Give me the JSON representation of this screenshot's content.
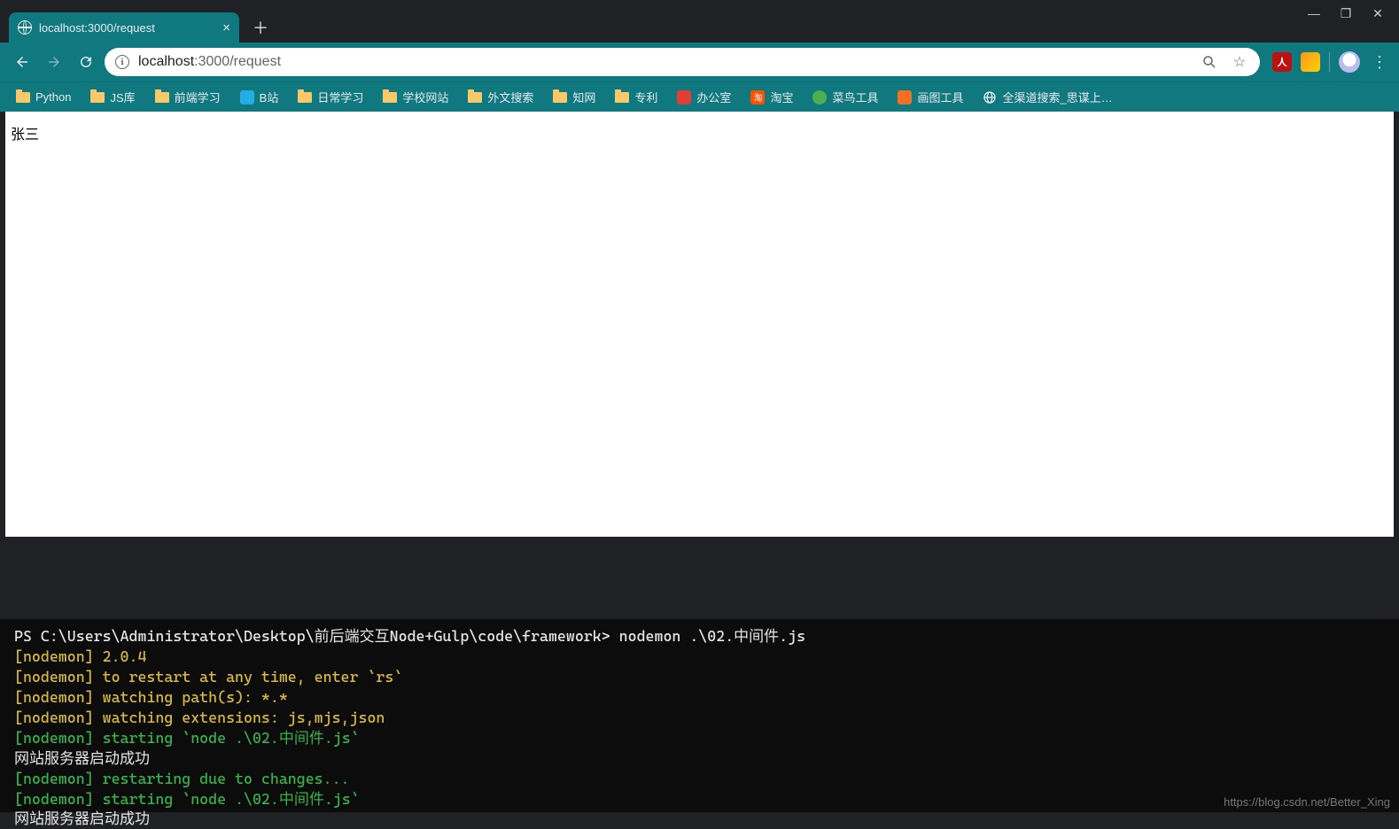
{
  "window_controls": {
    "min": "—",
    "max": "❐",
    "close": "✕"
  },
  "tab": {
    "title": "localhost:3000/request"
  },
  "address": {
    "host": "localhost",
    "path": ":3000/request"
  },
  "bookmarks": [
    {
      "label": "Python",
      "icon": "folder"
    },
    {
      "label": "JS库",
      "icon": "folder"
    },
    {
      "label": "前端学习",
      "icon": "folder"
    },
    {
      "label": "B站",
      "icon": "bili",
      "bg": "#23ade5"
    },
    {
      "label": "日常学习",
      "icon": "folder"
    },
    {
      "label": "学校网站",
      "icon": "folder"
    },
    {
      "label": "外文搜索",
      "icon": "folder"
    },
    {
      "label": "知网",
      "icon": "folder"
    },
    {
      "label": "专利",
      "icon": "folder"
    },
    {
      "label": "办公室",
      "icon": "square",
      "bg": "#e03e36"
    },
    {
      "label": "淘宝",
      "icon": "square",
      "bg": "#ff5000",
      "glyph": "淘"
    },
    {
      "label": "菜鸟工具",
      "icon": "round",
      "bg": "#4caf50"
    },
    {
      "label": "画图工具",
      "icon": "square",
      "bg": "#f36f21"
    },
    {
      "label": "全渠道搜索_思谋上…",
      "icon": "globe"
    }
  ],
  "page_body": "张三",
  "terminal": {
    "prompt_prefix": "PS C:\\Users\\Administrator\\Desktop\\前后端交互Node+Gulp\\code\\framework> ",
    "command": "nodemon .\\02.中间件.js",
    "lines": [
      {
        "cls": "t-yellow",
        "text": "[nodemon] 2.0.4"
      },
      {
        "cls": "t-yellow",
        "text": "[nodemon] to restart at any time, enter `rs`"
      },
      {
        "cls": "t-yellow",
        "text": "[nodemon] watching path(s): *.*"
      },
      {
        "cls": "t-yellow",
        "text": "[nodemon] watching extensions: js,mjs,json"
      },
      {
        "cls": "t-green",
        "text": "[nodemon] starting `node .\\02.中间件.js`"
      },
      {
        "cls": "t-white",
        "text": "网站服务器启动成功"
      },
      {
        "cls": "t-green",
        "text": "[nodemon] restarting due to changes..."
      },
      {
        "cls": "t-green",
        "text": "[nodemon] starting `node .\\02.中间件.js`"
      },
      {
        "cls": "t-white",
        "text": "网站服务器启动成功"
      }
    ]
  },
  "watermark": "https://blog.csdn.net/Better_Xing"
}
